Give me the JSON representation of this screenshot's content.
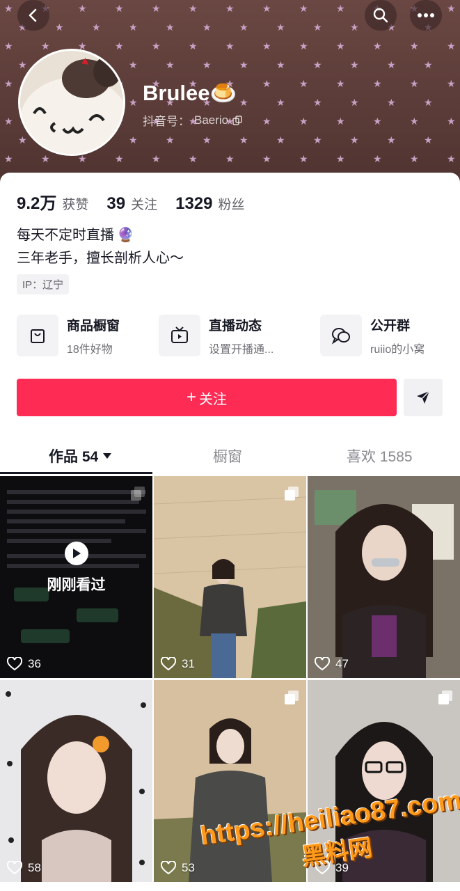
{
  "header": {
    "back_icon": "chevron-left-icon",
    "search_icon": "search-icon",
    "more_icon": "more-dots-icon"
  },
  "profile": {
    "name": "Brulee🍮",
    "id_label": "抖音号：",
    "id_value": "Baerio",
    "stats": [
      {
        "num": "9.2万",
        "label": "获赞"
      },
      {
        "num": "39",
        "label": "关注"
      },
      {
        "num": "1329",
        "label": "粉丝"
      }
    ],
    "bio_line1": "每天不定时直播",
    "bio_line1_emoji": "🔮",
    "bio_line2": "三年老手，擅长剖析人心～",
    "ip": "IP：辽宁"
  },
  "features": [
    {
      "title": "商品橱窗",
      "sub": "18件好物",
      "icon": "shopping-bag-icon"
    },
    {
      "title": "直播动态",
      "sub": "设置开播通...",
      "icon": "tv-icon"
    },
    {
      "title": "公开群",
      "sub": "ruiio的小窝",
      "icon": "chat-bubbles-icon"
    }
  ],
  "actions": {
    "follow_label": "关注",
    "follow_plus": "+",
    "share_icon": "send-icon"
  },
  "tabs": [
    {
      "label": "作品 54"
    },
    {
      "label": "橱窗"
    },
    {
      "label": "喜欢 1585"
    }
  ],
  "grid": [
    {
      "likes": "36",
      "overlay": "刚刚看过"
    },
    {
      "likes": "31"
    },
    {
      "likes": "47"
    },
    {
      "likes": "58"
    },
    {
      "likes": "53"
    },
    {
      "likes": "39"
    }
  ],
  "watermark": {
    "url": "https://heiliao87.com",
    "cn": "黑料网"
  },
  "colors": {
    "accent": "#fe2c55",
    "banner": "#5a3a36"
  }
}
